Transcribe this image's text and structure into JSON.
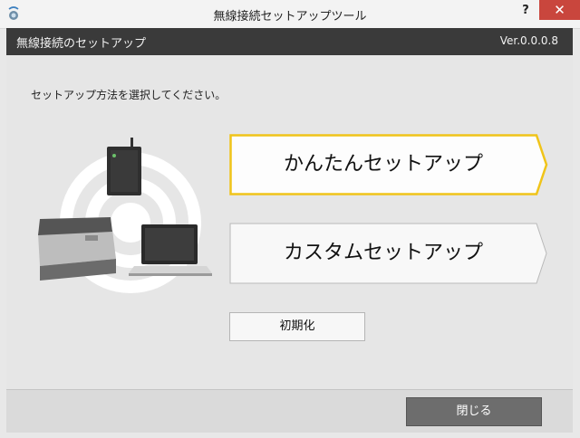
{
  "window": {
    "title": "無線接続セットアップツール",
    "help_label": "?",
    "close_label": "✕"
  },
  "header": {
    "title": "無線接続のセットアップ",
    "version": "Ver.0.0.0.8"
  },
  "main": {
    "instruction": "セットアップ方法を選択してください。",
    "easy_setup_label": "かんたんセットアップ",
    "custom_setup_label": "カスタムセットアップ",
    "initialize_label": "初期化"
  },
  "footer": {
    "close_label": "閉じる"
  },
  "colors": {
    "accent_border": "#f0c419",
    "header_bg": "#3a3a3a",
    "window_close_bg": "#c9463d",
    "footer_button_bg": "#6d6d6d"
  },
  "icons": [
    "app-icon",
    "wireless-router-icon",
    "scanner-icon",
    "laptop-icon",
    "signal-rings-icon"
  ]
}
